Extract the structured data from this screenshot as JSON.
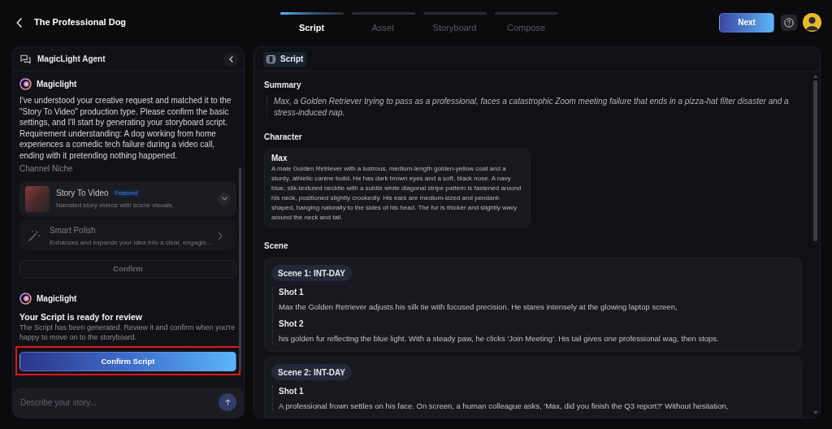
{
  "header": {
    "title": "The Professional Dog",
    "steps": [
      {
        "label": "Script",
        "selected": true
      },
      {
        "label": "Asset",
        "selected": false
      },
      {
        "label": "Storyboard",
        "selected": false
      },
      {
        "label": "Compose",
        "selected": false
      }
    ],
    "next_button": "Next"
  },
  "agent_panel": {
    "title": "MagicLight Agent",
    "messages": [
      {
        "kind": "choice",
        "sender": "Magiclight",
        "text": "I've understood your creative request and matched it to the \"Story To Video\" production type. Please confirm the basic settings, and I'll start by generating your storyboard script. Requirement understanding: A dog working from home experiences a comedic tech failure during a video call, ending with it pretending nothing happened.",
        "section_label": "Channel Niche",
        "options": [
          {
            "kind": "niche",
            "title": "Story To Video",
            "badge": "Featured",
            "description": "Narrated story videos with scene visuals.",
            "disabled": false
          },
          {
            "kind": "enhancer",
            "title": "Smart Polish",
            "description": "Enhances and expands your idea into a clear, engagin…",
            "disabled": true
          }
        ],
        "button": {
          "label": "Confirm",
          "disabled": true
        }
      },
      {
        "kind": "review",
        "sender": "Magiclight",
        "heading": "Your Script is ready for review",
        "text": "The Script has been generated. Review it and confirm when you're happy to move on to the storyboard.",
        "button": {
          "label": "Confirm Script",
          "highlighted": true
        }
      }
    ],
    "input": {
      "placeholder": "Describe your story..."
    }
  },
  "script_panel": {
    "tab": "Script",
    "summary_label": "Summary",
    "summary": "Max, a Golden Retriever trying to pass as a professional, faces a catastrophic Zoom meeting failure that ends in a pizza-hat filter disaster and a stress-induced nap.",
    "character_label": "Character",
    "characters": [
      {
        "name": "Max",
        "description": "A male Golden Retriever with a lustrous, medium-length golden-yellow coat and a sturdy, athletic canine build. He has dark brown eyes and a soft, black nose. A navy blue, silk-textured necktie with a subtle white diagonal stripe pattern is fastened around his neck, positioned slightly crookedly. His ears are medium-sized and pendant-shaped, hanging naturally to the sides of his head. The fur is thicker and slightly wavy around the neck and tail."
      }
    ],
    "scene_label": "Scene",
    "scenes": [
      {
        "title": "Scene 1: INT-DAY",
        "shots": [
          {
            "label": "Shot 1",
            "text": "Max the Golden Retriever adjusts his silk tie with focused precision. He stares intensely at the glowing laptop screen,"
          },
          {
            "label": "Shot 2",
            "text": "his golden fur reflecting the blue light. With a steady paw, he clicks 'Join Meeting'. His tail gives one professional wag, then stops."
          }
        ]
      },
      {
        "title": "Scene 2: INT-DAY",
        "shots": [
          {
            "label": "Shot 1",
            "text": "A professional frown settles on his face. On screen, a human colleague asks, 'Max, did you finish the Q3 report?' Without hesitation,"
          }
        ]
      }
    ]
  }
}
